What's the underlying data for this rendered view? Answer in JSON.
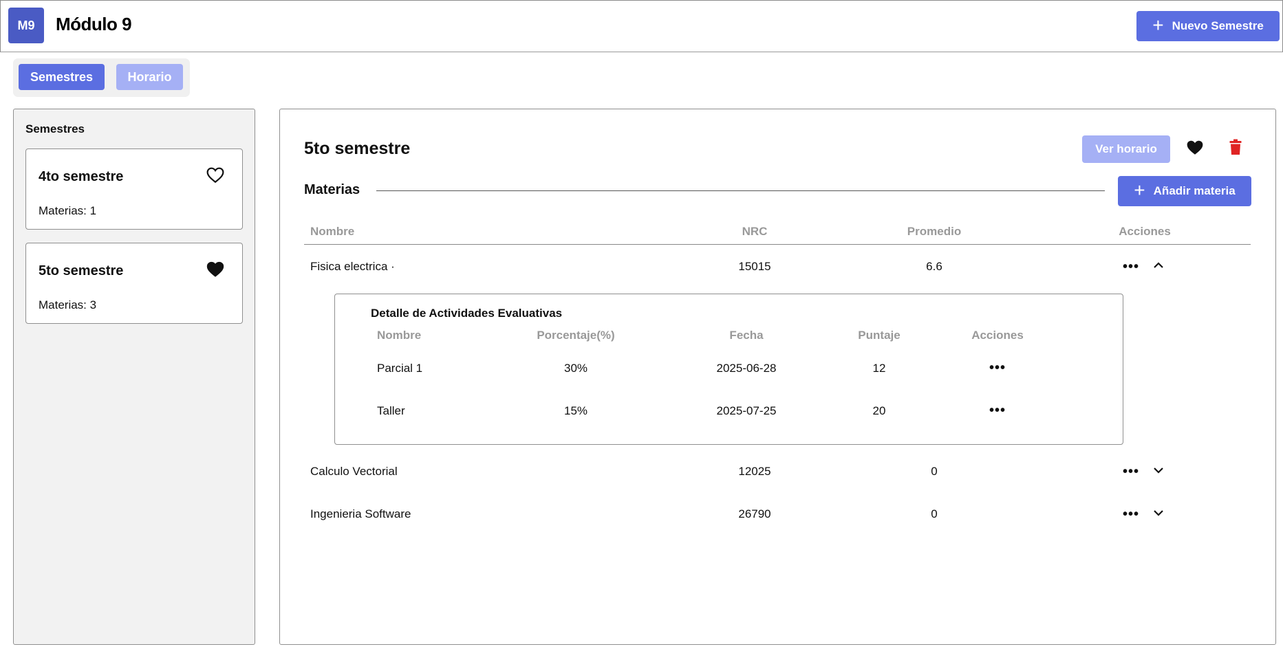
{
  "app": {
    "logo": "M9",
    "title": "Módulo 9",
    "new_semester_label": "Nuevo Semestre"
  },
  "tabs": [
    {
      "label": "Semestres",
      "active": true
    },
    {
      "label": "Horario",
      "active": false
    }
  ],
  "sidebar": {
    "title": "Semestres",
    "semesters": [
      {
        "name": "4to semestre",
        "count": "Materias: 1",
        "favorite": false,
        "icon": "heart-outline-icon"
      },
      {
        "name": "5to semestre",
        "count": "Materias: 3",
        "favorite": true,
        "icon": "heart-filled-icon"
      }
    ]
  },
  "main": {
    "title": "5to semestre",
    "ver_horario_label": "Ver horario",
    "materias_label": "Materias",
    "add_materia_label": "Añadir materia",
    "columns": {
      "nombre": "Nombre",
      "nrc": "NRC",
      "promedio": "Promedio",
      "acciones": "Acciones"
    },
    "subjects": [
      {
        "name": "Fisica electrica ·",
        "nrc": "15015",
        "promedio": "6.6",
        "expanded": true
      },
      {
        "name": "Calculo Vectorial",
        "nrc": "12025",
        "promedio": "0",
        "expanded": false
      },
      {
        "name": "Ingenieria Software",
        "nrc": "26790",
        "promedio": "0",
        "expanded": false
      }
    ],
    "detail": {
      "title": "Detalle de Actividades Evaluativas",
      "columns": {
        "nombre": "Nombre",
        "porcentaje": "Porcentaje(%)",
        "fecha": "Fecha",
        "puntaje": "Puntaje",
        "acciones": "Acciones"
      },
      "activities": [
        {
          "name": "Parcial 1",
          "porcentaje": "30%",
          "fecha": "2025-06-28",
          "puntaje": "12"
        },
        {
          "name": "Taller",
          "porcentaje": "15%",
          "fecha": "2025-07-25",
          "puntaje": "20"
        }
      ]
    }
  },
  "colors": {
    "primary": "#5b6ee1",
    "primary_light": "#a5b0f5",
    "logo": "#4a5bc4",
    "danger": "#e02424"
  },
  "more_glyph": "•••"
}
